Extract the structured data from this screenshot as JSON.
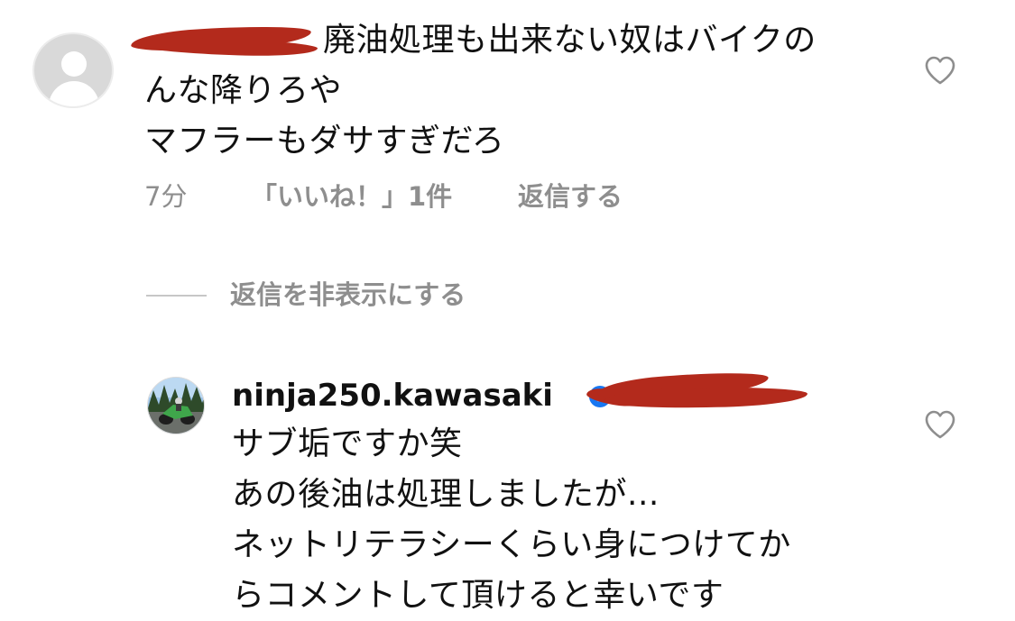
{
  "comment": {
    "text_line1": "廃油処理も出来ない奴はバイクの",
    "text_line2": "んな降りろや",
    "text_line3": "マフラーもダサすぎだろ",
    "time": "7分",
    "likes": "「いいね！」1件",
    "reply_label": "返信する"
  },
  "replies_toggle": {
    "label": "返信を非表示にする"
  },
  "reply": {
    "username": "ninja250.kawasaki",
    "text_line1": "サブ垢ですか笑",
    "text_line2": "あの後油は処理しましたが...",
    "text_line3": "ネットリテラシーくらい身につけてか",
    "text_line4": "らコメントして頂けると幸いです"
  },
  "colors": {
    "text": "#111111",
    "secondary_text": "#8e8e8e",
    "redaction": "#b32a1c",
    "verified_badge": "#1877f2"
  },
  "icons": {
    "like": "heart-outline-icon",
    "verified": "verified-badge-icon",
    "default_avatar": "default-avatar-icon"
  }
}
